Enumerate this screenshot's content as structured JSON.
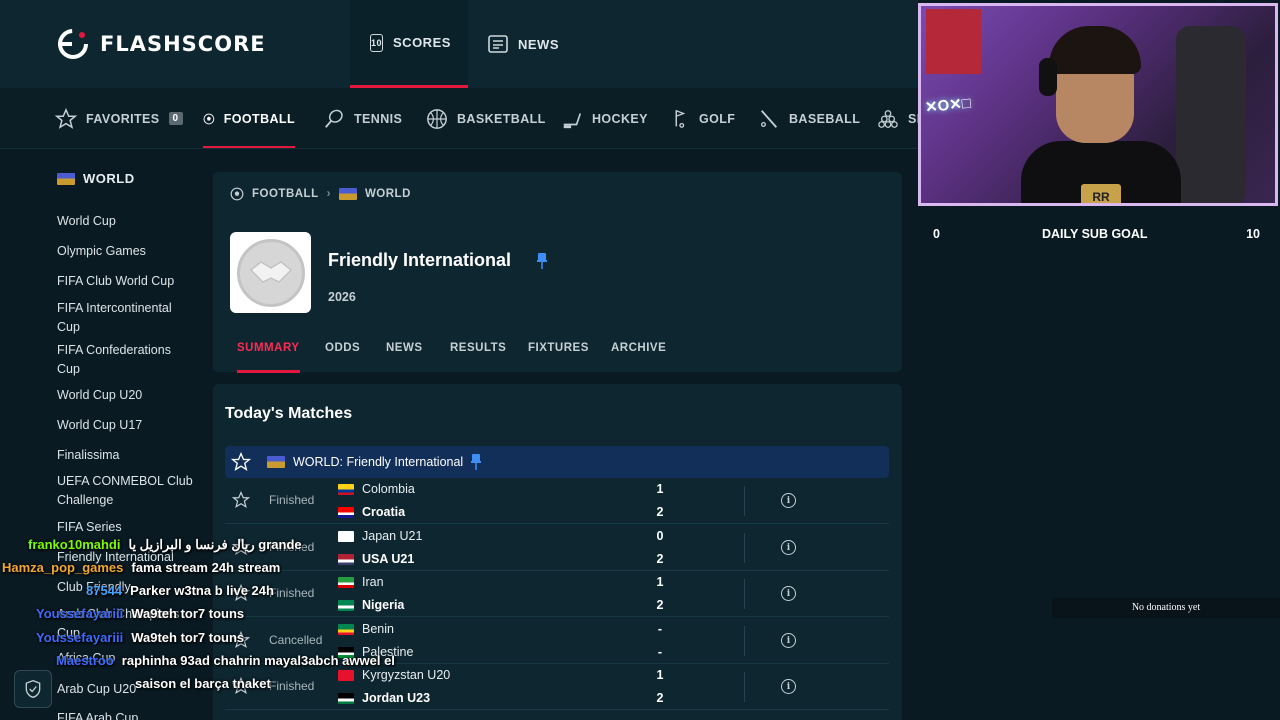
{
  "brand": {
    "name": "FLASHSCORE"
  },
  "top_tabs": [
    {
      "label": "SCORES",
      "icon": "scoreboard-icon",
      "active": true
    },
    {
      "label": "NEWS",
      "icon": "news-icon",
      "active": false
    }
  ],
  "sports": [
    {
      "label": "FAVORITES",
      "badge": "0",
      "icon": "star-icon"
    },
    {
      "label": "FOOTBALL",
      "icon": "football-icon",
      "active": true
    },
    {
      "label": "TENNIS",
      "icon": "tennis-icon"
    },
    {
      "label": "BASKETBALL",
      "icon": "basketball-icon"
    },
    {
      "label": "HOCKEY",
      "icon": "hockey-icon"
    },
    {
      "label": "GOLF",
      "icon": "golf-icon"
    },
    {
      "label": "BASEBALL",
      "icon": "baseball-icon"
    },
    {
      "label": "SN",
      "icon": "snooker-icon"
    }
  ],
  "sidebar": {
    "heading": "WORLD",
    "items": [
      "World Cup",
      "Olympic Games",
      "FIFA Club World Cup",
      "FIFA Intercontinental Cup",
      "FIFA Confederations Cup",
      "World Cup U20",
      "World Cup U17",
      "Finalissima",
      "UEFA CONMEBOL Club Challenge",
      "FIFA Series",
      "Friendly International",
      "Club Friendly",
      "Arab Club Champions Cup",
      "Africa Cup",
      "Arab Cup U20",
      "FIFA Arab Cup"
    ]
  },
  "breadcrumb": {
    "sport": "FOOTBALL",
    "region": "WORLD"
  },
  "league": {
    "title": "Friendly International",
    "season": "2026"
  },
  "subtabs": [
    {
      "label": "SUMMARY",
      "active": true
    },
    {
      "label": "ODDS"
    },
    {
      "label": "NEWS"
    },
    {
      "label": "RESULTS"
    },
    {
      "label": "FIXTURES"
    },
    {
      "label": "ARCHIVE"
    }
  ],
  "matches_section": {
    "title": "Today's Matches",
    "league_row": "WORLD: Friendly International",
    "matches": [
      {
        "status": "Finished",
        "home": "Colombia",
        "away": "Croatia",
        "home_score": "1",
        "away_score": "2",
        "winner": "away",
        "home_flag": [
          "#fcd116",
          "#003893",
          "#ce1126"
        ],
        "away_flag": [
          "#ff0000",
          "#ffffff",
          "#171796"
        ]
      },
      {
        "status": "Finished",
        "home": "Japan U21",
        "away": "USA U21",
        "home_score": "0",
        "away_score": "2",
        "winner": "away",
        "home_flag": [
          "#ffffff",
          "#ffffff",
          "#ffffff"
        ],
        "away_flag": [
          "#b22234",
          "#ffffff",
          "#3c3b6e"
        ]
      },
      {
        "status": "Finished",
        "home": "Iran",
        "away": "Nigeria",
        "home_score": "1",
        "away_score": "2",
        "winner": "away",
        "home_flag": [
          "#239f40",
          "#ffffff",
          "#da0000"
        ],
        "away_flag": [
          "#008751",
          "#ffffff",
          "#008751"
        ]
      },
      {
        "status": "Cancelled",
        "home": "Benin",
        "away": "Palestine",
        "home_score": "-",
        "away_score": "-",
        "winner": "none",
        "home_flag": [
          "#008751",
          "#fcd116",
          "#e8112d"
        ],
        "away_flag": [
          "#000000",
          "#ffffff",
          "#009736"
        ]
      },
      {
        "status": "Finished",
        "home": "Kyrgyzstan U20",
        "away": "Jordan U23",
        "home_score": "1",
        "away_score": "2",
        "winner": "away",
        "home_flag": [
          "#e8112d",
          "#e8112d",
          "#e8112d"
        ],
        "away_flag": [
          "#000000",
          "#ffffff",
          "#007a3d"
        ]
      }
    ]
  },
  "stream": {
    "goal_left": "0",
    "goal_label": "DAILY SUB GOAL",
    "goal_right": "10",
    "donations": "No donations yet"
  },
  "chat": [
    {
      "user": "franko10mahdi",
      "message": "ريال فرنسا و البرازيل يا grande",
      "color": "#7CFC00"
    },
    {
      "user": "Hamza_pop_games",
      "message": "fama stream 24h stream",
      "color": "#f0a830"
    },
    {
      "user": "87544",
      "message": "Parker w3tna b live 24h",
      "color": "#4aa3ff"
    },
    {
      "user": "Youssefayariii",
      "message": "Wa9teh tor7 touns",
      "color": "#3d6bff"
    },
    {
      "user": "Youssefayariii",
      "message": "Wa9teh tor7 touns",
      "color": "#3d6bff"
    },
    {
      "user": "Maestroo",
      "message": "raphinha 93ad chahrin mayal3abch awwel el",
      "color": "#3d6bff"
    },
    {
      "user": "",
      "message": "saison el barça tnaket",
      "color": "#ffffff"
    }
  ],
  "colors": {
    "accent": "#e4173e",
    "header": "#0e2630",
    "background": "#0a1a22",
    "league_row": "#122f5a"
  }
}
